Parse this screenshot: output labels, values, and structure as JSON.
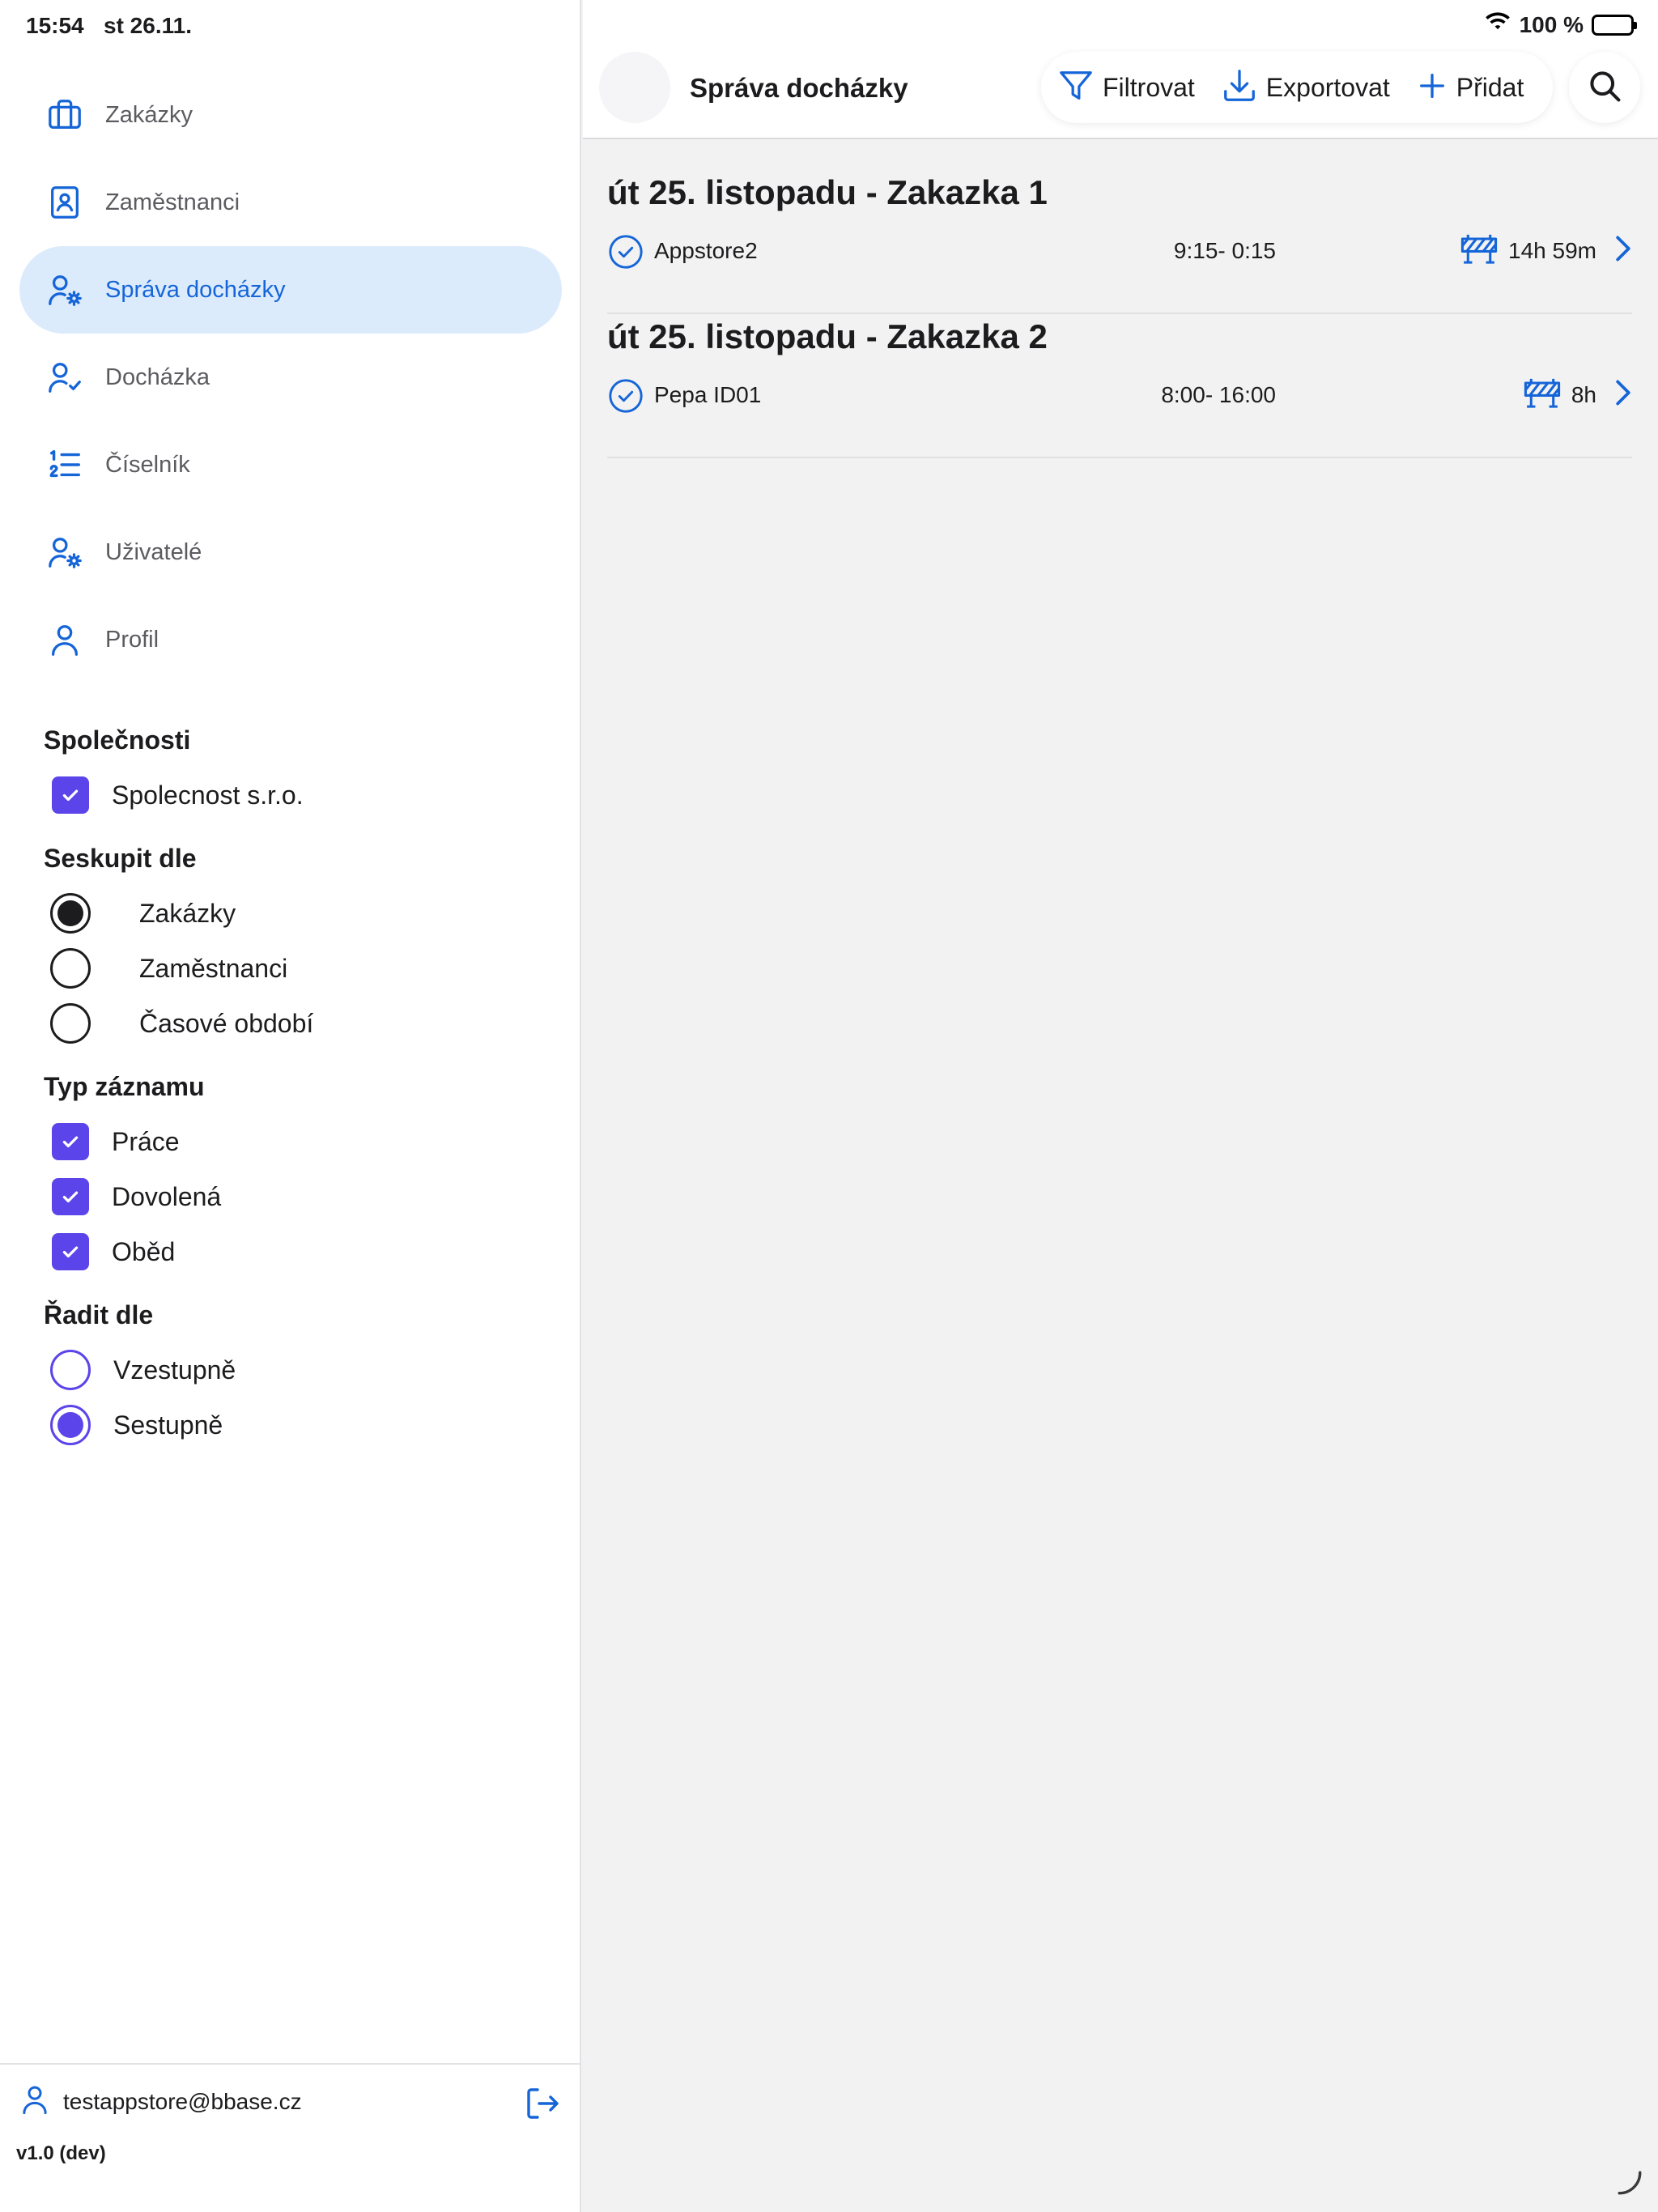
{
  "status_bar": {
    "time": "15:54",
    "date": "st 26.11.",
    "battery": "100 %",
    "battery_level": 1.0
  },
  "sidebar": {
    "nav": [
      {
        "label": "Zakázky",
        "icon": "briefcase-icon",
        "active": false
      },
      {
        "label": "Zaměstnanci",
        "icon": "contact-book-icon",
        "active": false
      },
      {
        "label": "Správa docházky",
        "icon": "user-gear-icon",
        "active": true
      },
      {
        "label": "Docházka",
        "icon": "user-check-icon",
        "active": false
      },
      {
        "label": "Číselník",
        "icon": "numbered-list-icon",
        "active": false
      },
      {
        "label": "Uživatelé",
        "icon": "user-gear-icon",
        "active": false
      },
      {
        "label": "Profil",
        "icon": "user-icon",
        "active": false
      }
    ],
    "filters": {
      "companies": {
        "title": "Společnosti",
        "items": [
          {
            "label": "Spolecnost s.r.o.",
            "checked": true
          }
        ]
      },
      "group_by": {
        "title": "Seskupit dle",
        "options": [
          {
            "label": "Zakázky",
            "selected": true
          },
          {
            "label": "Zaměstnanci",
            "selected": false
          },
          {
            "label": "Časové období",
            "selected": false
          }
        ]
      },
      "record_type": {
        "title": "Typ záznamu",
        "items": [
          {
            "label": "Práce",
            "checked": true
          },
          {
            "label": "Dovolená",
            "checked": true
          },
          {
            "label": "Oběd",
            "checked": true
          }
        ]
      },
      "sort_by": {
        "title": "Řadit dle",
        "options": [
          {
            "label": "Vzestupně",
            "selected": false
          },
          {
            "label": "Sestupně",
            "selected": true
          }
        ]
      }
    },
    "footer": {
      "email": "testappstore@bbase.cz",
      "version": "v1.0 (dev)"
    }
  },
  "header": {
    "title": "Správa docházky",
    "filter_label": "Filtrovat",
    "export_label": "Exportovat",
    "add_label": "Přidat"
  },
  "groups": [
    {
      "title": "út 25. listopadu - Zakazka 1",
      "entries": [
        {
          "name": "Appstore2",
          "time": "9:15- 0:15",
          "duration": "14h 59m"
        }
      ]
    },
    {
      "title": "út 25. listopadu - Zakazka 2",
      "entries": [
        {
          "name": "Pepa ID01",
          "time": "8:00- 16:00",
          "duration": "8h"
        }
      ]
    }
  ],
  "colors": {
    "accent": "#1565d8",
    "active_bg": "#dcebfc",
    "checkbox": "#5b45ea",
    "background": "#f2f2f2"
  }
}
